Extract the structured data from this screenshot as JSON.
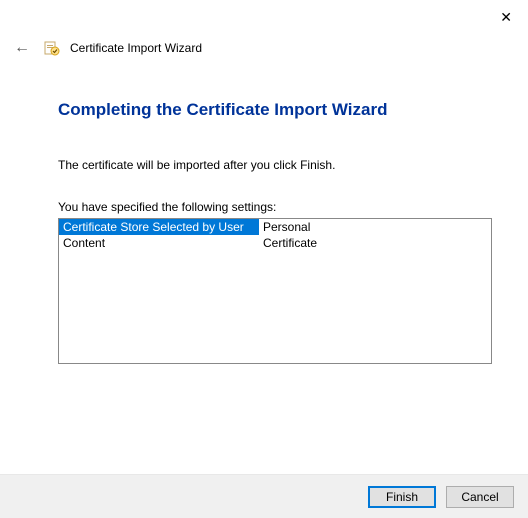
{
  "window": {
    "title": "Certificate Import Wizard"
  },
  "page": {
    "heading": "Completing the Certificate Import Wizard",
    "description": "The certificate will be imported after you click Finish.",
    "settings_label": "You have specified the following settings:",
    "settings": [
      {
        "label": "Certificate Store Selected by User",
        "value": "Personal",
        "selected": true
      },
      {
        "label": "Content",
        "value": "Certificate",
        "selected": false
      }
    ]
  },
  "buttons": {
    "finish": "Finish",
    "cancel": "Cancel"
  },
  "icons": {
    "close": "✕",
    "back": "←"
  }
}
